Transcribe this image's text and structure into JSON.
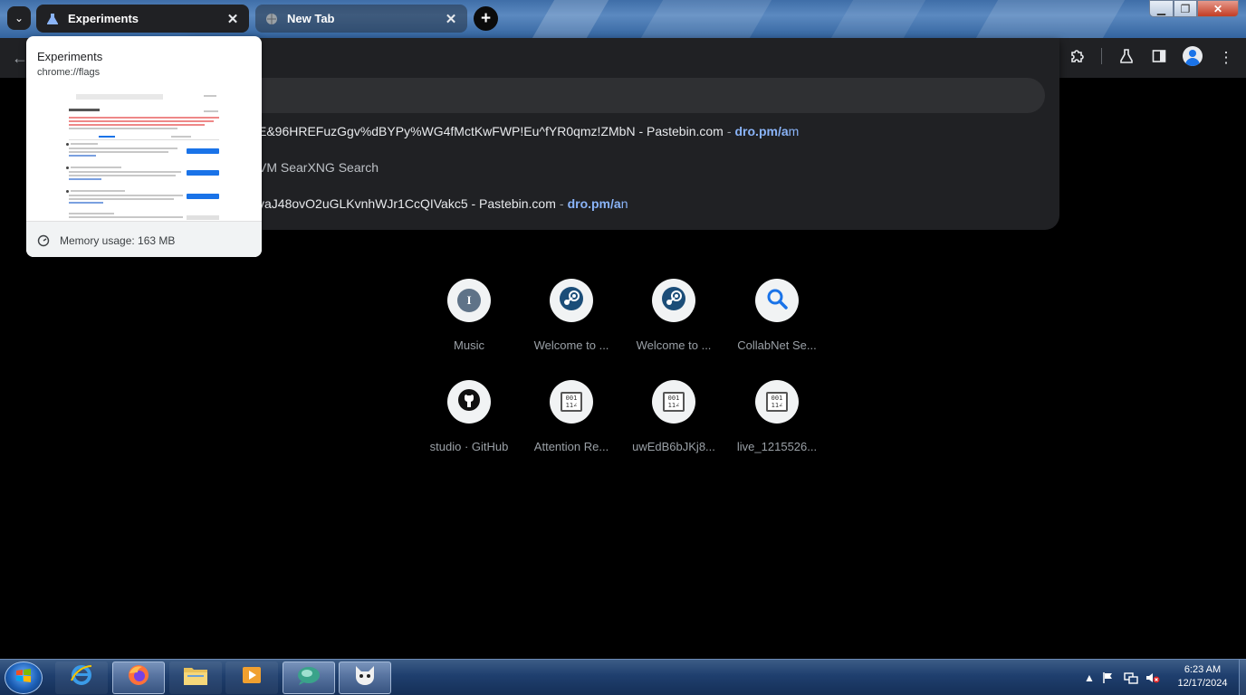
{
  "tabs": [
    {
      "title": "Experiments",
      "favicon": "flask-icon",
      "active": true
    },
    {
      "title": "New Tab",
      "favicon": "globe-icon",
      "active": false
    }
  ],
  "hover_card": {
    "title": "Experiments",
    "url": "chrome://flags",
    "memory": "Memory usage: 163 MB"
  },
  "omnibox": {
    "suggestions": [
      {
        "text": "E&96HREFuzGgv%dBYPy%WG4fMctKwFWP!Eu^fYR0qmz!ZMbN - Pastebin.com",
        "url_bold": "dro.pm/a",
        "url_rest": "m"
      },
      {
        "text": "VM SearXNG Search"
      },
      {
        "text": "yaJ48ovO2uGLKvnhWJr1CcQIVakc5 - Pastebin.com",
        "url_bold": "dro.pm/a",
        "url_rest": "n"
      }
    ]
  },
  "shortcuts": [
    {
      "label": "Music",
      "icon": "letter-icon",
      "letter": "I"
    },
    {
      "label": "Welcome to ...",
      "icon": "steam-icon"
    },
    {
      "label": "Welcome to ...",
      "icon": "steam-icon"
    },
    {
      "label": "CollabNet Se...",
      "icon": "search-icon"
    },
    {
      "label": "studio · GitHub",
      "icon": "github-icon"
    },
    {
      "label": "Attention Re...",
      "icon": "binary-file-icon"
    },
    {
      "label": "uwEdB6bJKj8...",
      "icon": "binary-file-icon"
    },
    {
      "label": "live_1215526...",
      "icon": "binary-file-icon"
    }
  ],
  "binary_glyph": "001\n11∠",
  "taskbar": {
    "clock_time": "6:23 AM",
    "clock_date": "12/17/2024"
  }
}
